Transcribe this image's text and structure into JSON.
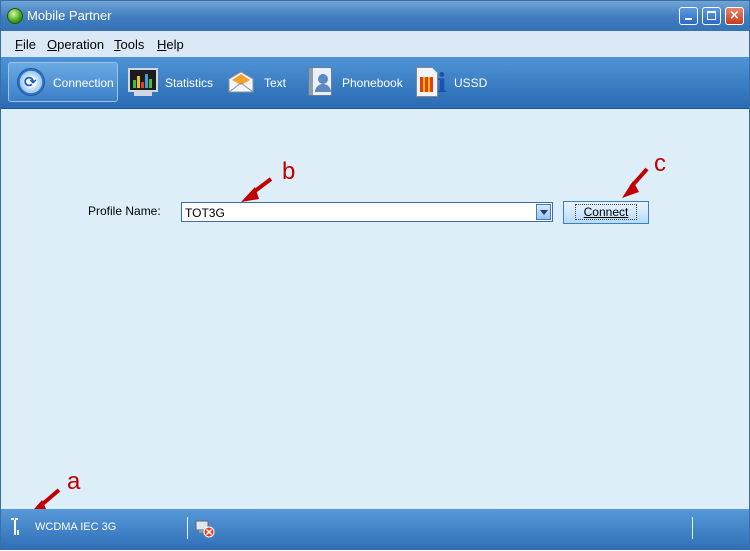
{
  "window": {
    "title": "Mobile Partner"
  },
  "menu": [
    {
      "mnemonic": "F",
      "rest": "ile"
    },
    {
      "mnemonic": "O",
      "rest": "peration"
    },
    {
      "mnemonic": "T",
      "rest": "ools"
    },
    {
      "mnemonic": "H",
      "rest": "elp"
    }
  ],
  "toolbar": {
    "selected": "Connection",
    "items": [
      {
        "label": "Connection",
        "icon": "connection-icon"
      },
      {
        "label": "Statistics",
        "icon": "statistics-monitor-icon"
      },
      {
        "label": "Text",
        "icon": "envelope-icon"
      },
      {
        "label": "Phonebook",
        "icon": "phonebook-icon"
      },
      {
        "label": "USSD",
        "icon": "sim-card-info-icon"
      }
    ]
  },
  "profile": {
    "label": "Profile Name:",
    "value": "TOT3G"
  },
  "connect": {
    "label": "Connect"
  },
  "annotations": {
    "a": "a",
    "b": "b",
    "c": "c",
    "color": "#c00000"
  },
  "status": {
    "network": "WCDMA  IEC 3G"
  },
  "colors": {
    "accent": "#2f70b8",
    "content_bg": "#ddeef9"
  }
}
